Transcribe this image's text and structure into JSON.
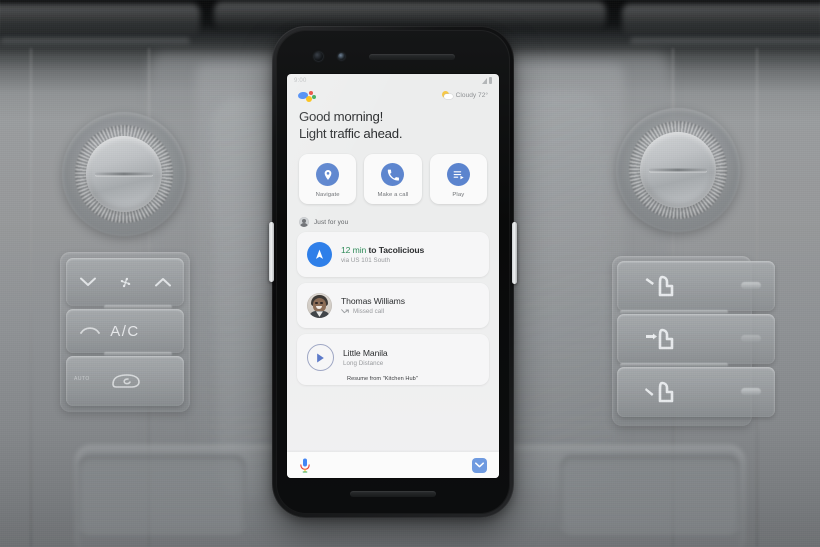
{
  "scene": {
    "description": "Google Assistant driving mode on a phone docked in a car dashboard"
  },
  "car": {
    "left_controls": {
      "knob_label": "temperature-knob-left",
      "fan_down_icon": "chevron-down-icon",
      "fan_icon": "fan-icon",
      "fan_up_icon": "chevron-up-icon",
      "ac_label": "A/C",
      "windshield_icon": "windshield-defrost-icon",
      "recirculate_icon": "air-recirculate-icon",
      "auto_label": "AUTO"
    },
    "right_controls": {
      "knob_label": "temperature-knob-right",
      "airflow_face_icon": "airflow-face-icon",
      "airflow_face_feet_icon": "airflow-face-feet-icon",
      "airflow_feet_icon": "airflow-feet-icon"
    }
  },
  "phone": {
    "statusbar": {
      "time": "9:00",
      "signal_icon": "signal-bars-icon",
      "battery_icon": "battery-icon"
    },
    "header": {
      "assistant_logo": "google-assistant-dots-icon",
      "weather_icon": "sun-cloud-icon",
      "weather_text": "Cloudy 72°"
    },
    "greeting": {
      "line1": "Good morning!",
      "line2": "Light traffic ahead."
    },
    "actions": [
      {
        "label": "Navigate",
        "icon": "map-pin-icon"
      },
      {
        "label": "Make a call",
        "icon": "phone-icon"
      },
      {
        "label": "Play",
        "icon": "playlist-play-icon"
      }
    ],
    "just_for_you": {
      "label": "Just for you",
      "icon": "person-avatar-icon"
    },
    "cards": [
      {
        "type": "navigation",
        "icon": "navigation-arrow-icon",
        "eta": "12 min",
        "destination": "to Tacolicious",
        "subtitle": "via US 101 South"
      },
      {
        "type": "missed-call",
        "icon": "contact-photo-avatar",
        "name": "Thomas Williams",
        "status_icon": "missed-call-arrow-icon",
        "status": "Missed call"
      },
      {
        "type": "media",
        "icon": "play-circle-icon",
        "title": "Little Manila",
        "artist": "Long Distance",
        "resume": "Resume from \"Kitchen Hub\""
      }
    ],
    "bottombar": {
      "mic_icon": "microphone-icon",
      "collapse_icon": "chevron-down-icon"
    }
  },
  "colors": {
    "assistant_blue": "#4285f4",
    "assistant_red": "#ea4335",
    "assistant_yellow": "#fbbc05",
    "assistant_green": "#34a853",
    "action_icon_blue": "#5b84ce",
    "nav_icon_blue": "#2b7de9",
    "eta_green": "#2d8a57",
    "chevron_button_blue": "#6f9ae0",
    "screen_bg": "#eceded",
    "card_bg": "#f6f6f7"
  }
}
